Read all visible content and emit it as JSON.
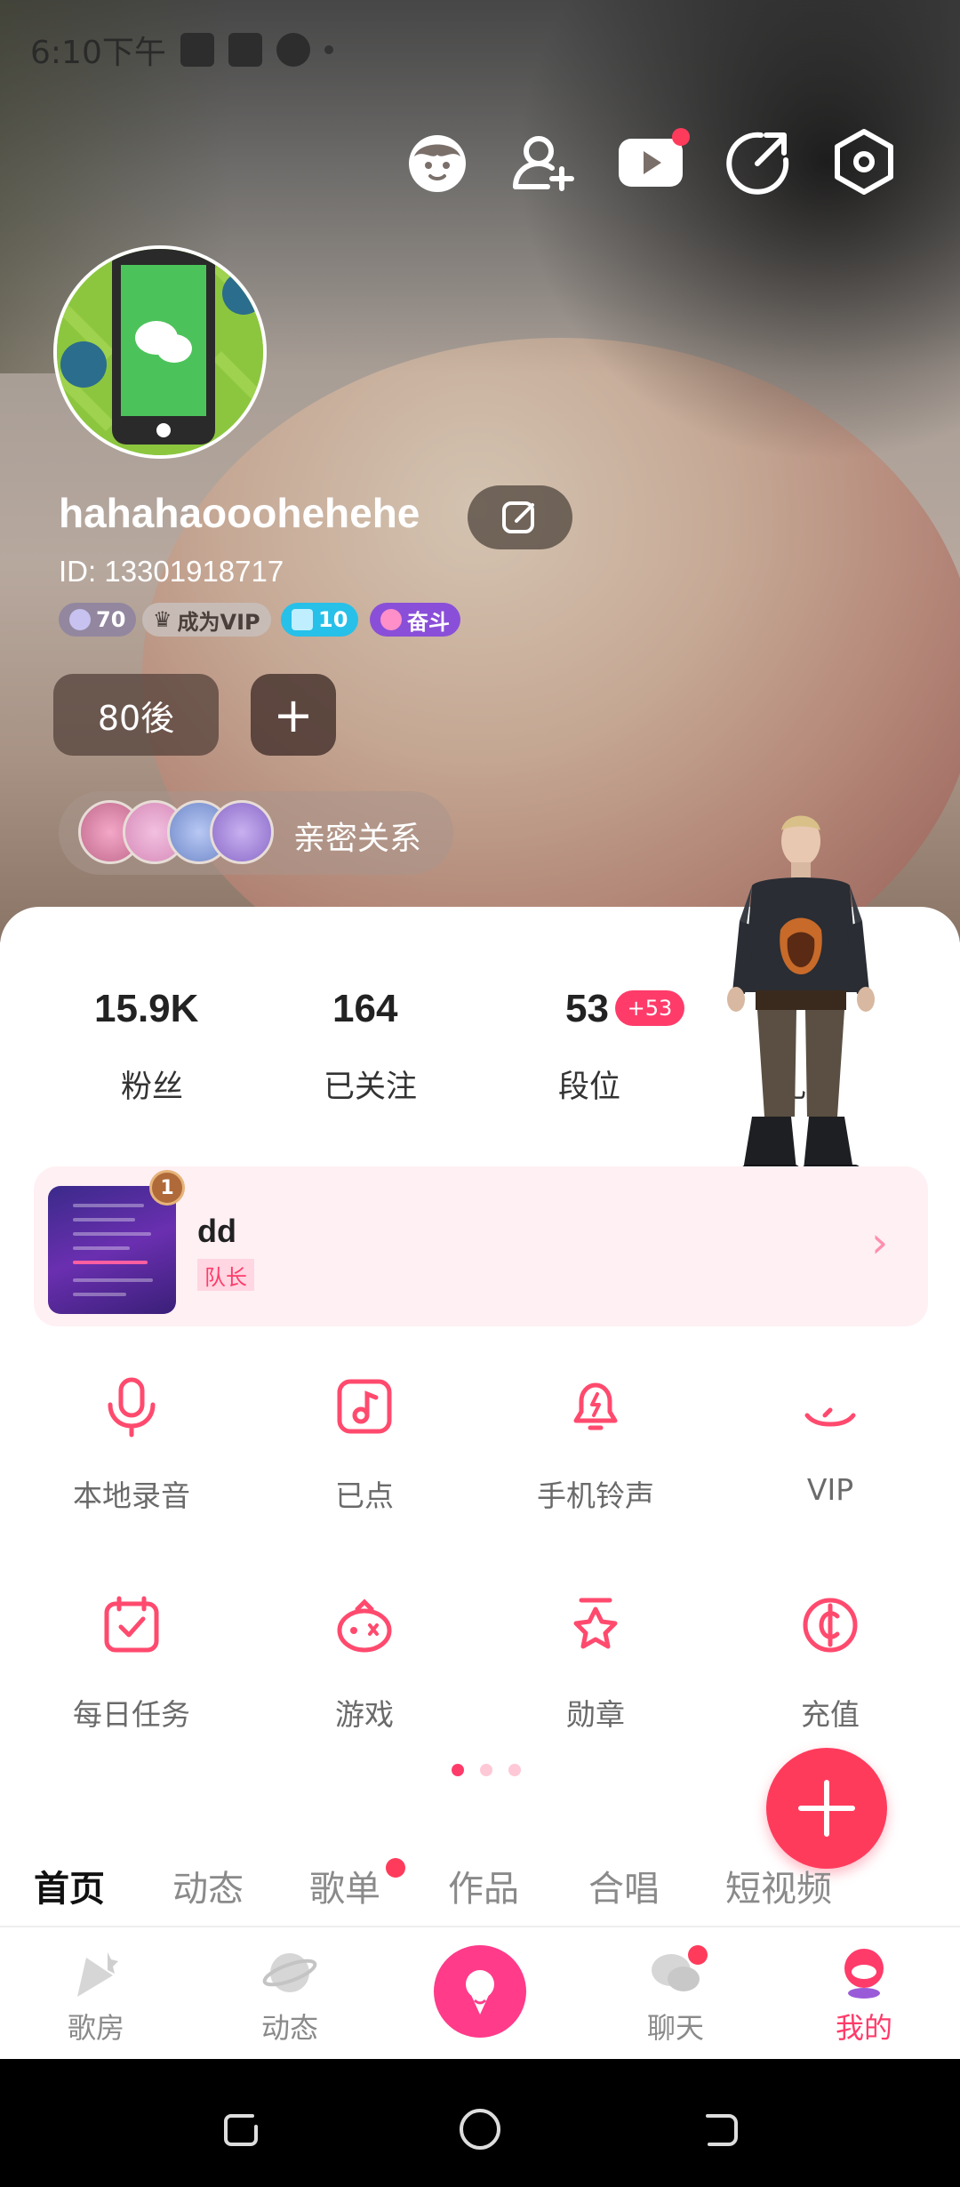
{
  "status_bar": {
    "time": "6:10下午"
  },
  "profile": {
    "username": "hahahaooohehehe",
    "id_text": "ID: 13301918717",
    "badges": {
      "level": "70",
      "vip": "成为VIP",
      "diamond": "10",
      "rank": "奋斗"
    },
    "tag": "80後",
    "tag_add": "+",
    "intimate_label": "亲密关系"
  },
  "stats": [
    {
      "value": "15.9K",
      "label": "粉丝"
    },
    {
      "value": "164",
      "label": "已关注"
    },
    {
      "value": "53",
      "label": "段位",
      "delta": "+53"
    }
  ],
  "stats_extra_label": "礼",
  "group": {
    "name": "dd",
    "role": "队长",
    "badge": "1"
  },
  "grid": [
    {
      "label": "本地录音",
      "icon": "microphone-icon"
    },
    {
      "label": "已点",
      "icon": "music-note-icon"
    },
    {
      "label": "手机铃声",
      "icon": "bell-icon"
    },
    {
      "label": "VIP",
      "icon": "vip-icon"
    },
    {
      "label": "每日任务",
      "icon": "calendar-check-icon"
    },
    {
      "label": "游戏",
      "icon": "game-icon"
    },
    {
      "label": "勋章",
      "icon": "medal-icon"
    },
    {
      "label": "充值",
      "icon": "coin-icon"
    }
  ],
  "profile_tabs": [
    "首页",
    "动态",
    "歌单",
    "作品",
    "合唱",
    "短视频"
  ],
  "bottom_nav": [
    {
      "label": "歌房",
      "icon": "song-room-icon"
    },
    {
      "label": "动态",
      "icon": "planet-icon"
    },
    {
      "label": "聊天",
      "icon": "chat-icon"
    },
    {
      "label": "我的",
      "icon": "me-icon"
    }
  ],
  "colors": {
    "accent": "#ff3b5c",
    "active_nav": "#ff3b6a"
  }
}
